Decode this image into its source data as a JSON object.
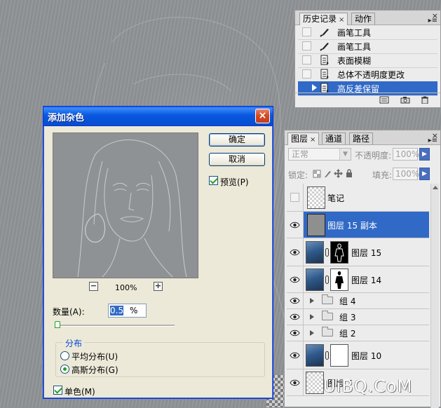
{
  "history_panel": {
    "tabs": [
      {
        "label": "历史记录",
        "close": "×"
      },
      {
        "label": "动作"
      }
    ],
    "close_glyph": "×",
    "menu_glyph": "▸≡",
    "items": [
      {
        "label": "画笔工具",
        "icon": "brush-icon"
      },
      {
        "label": "画笔工具",
        "icon": "brush-icon"
      },
      {
        "label": "表面模糊",
        "icon": "history-doc-icon"
      },
      {
        "label": "总体不透明度更改",
        "icon": "history-doc-icon"
      },
      {
        "label": "高反差保留",
        "icon": "history-doc-icon",
        "selected": true
      }
    ],
    "footer_icons": [
      "new-document-from-state-icon",
      "camera-snapshot-icon",
      "trash-icon"
    ]
  },
  "layers_panel": {
    "tabs": [
      {
        "label": "图层",
        "close": "×"
      },
      {
        "label": "通道"
      },
      {
        "label": "路径"
      }
    ],
    "close_glyph": "×",
    "menu_glyph": "▸≡",
    "blend_mode": "正常",
    "opacity_label": "不透明度:",
    "opacity_value": "100%",
    "lock_label": "锁定:",
    "fill_label": "填充:",
    "fill_value": "100%",
    "layers": [
      {
        "name": "笔记",
        "visible": false,
        "thumb": "checker"
      },
      {
        "name": "图层 15 副本",
        "visible": true,
        "thumb": "gray",
        "selected": true
      },
      {
        "name": "图层 15",
        "visible": true,
        "thumb": "photo",
        "mask": "black"
      },
      {
        "name": "图层 14",
        "visible": true,
        "thumb": "photo",
        "mask": "white"
      },
      {
        "name": "组 4",
        "visible": true,
        "group": true
      },
      {
        "name": "组 3",
        "visible": true,
        "group": true
      },
      {
        "name": "组 2",
        "visible": true,
        "group": true
      },
      {
        "name": "图层 10",
        "visible": true,
        "thumb": "photo",
        "mask": "plain-white"
      },
      {
        "name": "图层 7",
        "visible": true,
        "thumb": "checker"
      }
    ]
  },
  "dialog": {
    "title": "添加杂色",
    "close_glyph": "×",
    "ok_label": "确定",
    "cancel_label": "取消",
    "preview_label": "预览(P)",
    "preview_checked": true,
    "zoom_out_glyph": "−",
    "zoom_in_glyph": "+",
    "zoom_level": "100%",
    "amount_label": "数量(A):",
    "amount_value": "0.5",
    "amount_unit": "%",
    "amount_slider_fraction": 0.003,
    "distribution": {
      "legend": "分布",
      "options": [
        {
          "label": "平均分布(U)",
          "selected": false
        },
        {
          "label": "高斯分布(G)",
          "selected": true
        }
      ]
    },
    "mono_label": "单色(M)",
    "mono_checked": true
  },
  "watermark": "UiBQ.CoM",
  "colors": {
    "selection_blue": "#3169c6",
    "xp_title_blue": "#0a58df",
    "xp_close_red": "#d3481e",
    "check_green": "#21a121"
  }
}
